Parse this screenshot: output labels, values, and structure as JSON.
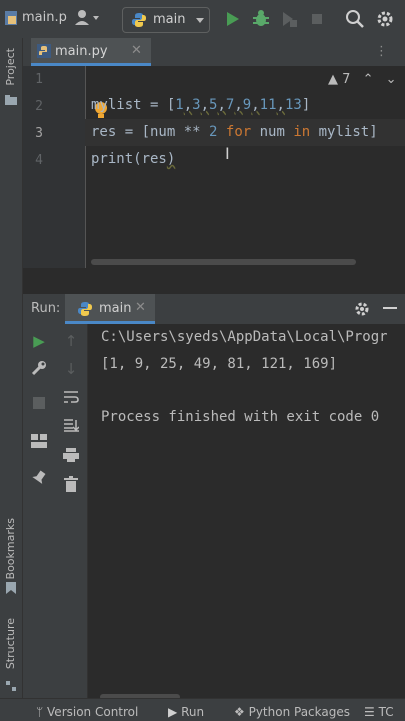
{
  "toolbar": {
    "file_title": "main.p",
    "run_config": "main",
    "icons": [
      "python-file-icon",
      "user-icon",
      "run-icon",
      "debug-icon",
      "coverage-icon",
      "stop-icon",
      "search-icon",
      "settings-icon"
    ]
  },
  "left_strip": {
    "project_label": "Project",
    "bookmarks_label": "Bookmarks",
    "structure_label": "Structure"
  },
  "editor": {
    "tab_label": "main.py",
    "warning_count": "7",
    "line_numbers": [
      "1",
      "2",
      "3",
      "4"
    ],
    "code_lines": [
      "",
      "mylist = [1,3,5,7,9,11,13]",
      "res = [num ** 2 for num in mylist]",
      "print(res)"
    ]
  },
  "run_panel": {
    "header_label": "Run:",
    "tab_label": "main",
    "console_lines": [
      "C:\\Users\\syeds\\AppData\\Local\\Progr",
      "[1, 9, 25, 49, 81, 121, 169]",
      "",
      "Process finished with exit code 0"
    ]
  },
  "status_bar": {
    "version_control": "Version Control",
    "run": "Run",
    "python_packages": "Python Packages",
    "todo": "TC"
  },
  "colors": {
    "background": "#2b2b2b",
    "panel": "#3c3f41",
    "run_green": "#499c54",
    "debug_green": "#59a869",
    "keyword": "#cc7832",
    "number": "#6897bb",
    "accent": "#4a88c7"
  }
}
